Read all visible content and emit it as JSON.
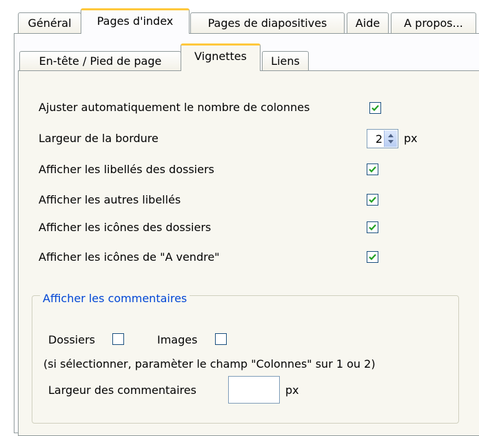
{
  "tabs": [
    {
      "label": "Général",
      "active": false
    },
    {
      "label": "Pages d'index",
      "active": true
    },
    {
      "label": "Pages de diapositives",
      "active": false
    },
    {
      "label": "Aide",
      "active": false
    },
    {
      "label": "A propos...",
      "active": false
    }
  ],
  "subtabs": [
    {
      "label": "En-tête / Pied de page",
      "active": false
    },
    {
      "label": "Vignettes",
      "active": true
    },
    {
      "label": "Liens",
      "active": false
    }
  ],
  "options": [
    {
      "label": "Ajuster automatiquement le nombre de colonnes",
      "checked": true
    },
    {
      "label": "Afficher les libellés des dossiers",
      "checked": true
    },
    {
      "label": "Afficher les autres libellés",
      "checked": true
    },
    {
      "label": "Afficher les icônes des dossiers",
      "checked": true
    },
    {
      "label": "Afficher les icônes de \"A vendre\"",
      "checked": true
    }
  ],
  "border_width": {
    "label": "Largeur de la bordure",
    "value": "2",
    "unit": "px"
  },
  "comments": {
    "title": "Afficher les commentaires",
    "folders_label": "Dossiers",
    "folders_checked": false,
    "images_label": "Images",
    "images_checked": false,
    "hint": "(si sélectionner, paramèter le champ \"Colonnes\" sur 1 ou 2)",
    "width_label": "Largeur des commentaires",
    "width_value": "",
    "width_unit": "px"
  },
  "colors": {
    "accent": "#ffc83c",
    "check": "#21a121",
    "group_title": "#0046d5"
  }
}
